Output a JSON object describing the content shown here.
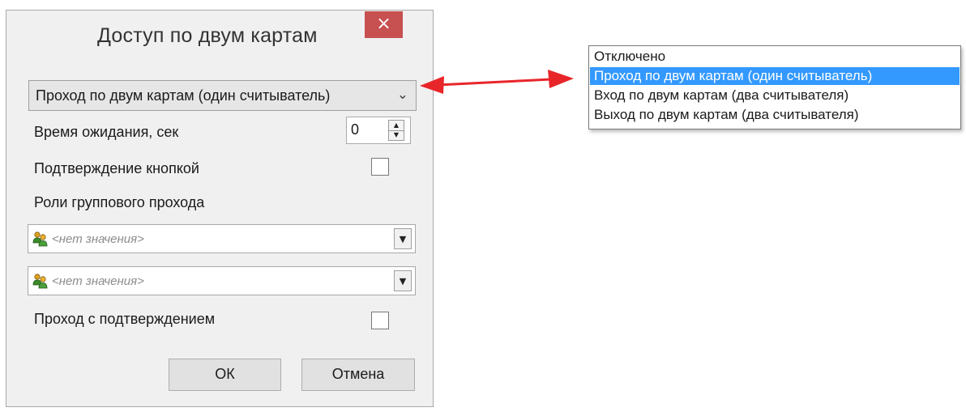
{
  "dialog": {
    "title": "Доступ по двум картам",
    "close_glyph": "×",
    "mode_selected": "Проход по двум картам (один считыватель)",
    "timeout_label": "Время ожидания, сек",
    "timeout_value": "0",
    "button_confirm_label": "Подтверждение кнопкой",
    "group_roles_label": "Роли группового прохода",
    "role_combos": [
      {
        "placeholder": "<нет значения>",
        "icon": "user-group-icon"
      },
      {
        "placeholder": "<нет значения>",
        "icon": "user-group-icon"
      }
    ],
    "pass_confirm_label": "Проход с подтверждением",
    "ok_label": "ОК",
    "cancel_label": "Отмена"
  },
  "dropdown": {
    "items": [
      "Отключено",
      "Проход по двум картам (один считыватель)",
      "Вход по двум картам (два считывателя)",
      "Выход по двум картам (два считывателя)"
    ],
    "selected_index": 1
  },
  "colors": {
    "close_button": "#c75050",
    "selection": "#3399ff",
    "arrow": "#e8262a"
  }
}
